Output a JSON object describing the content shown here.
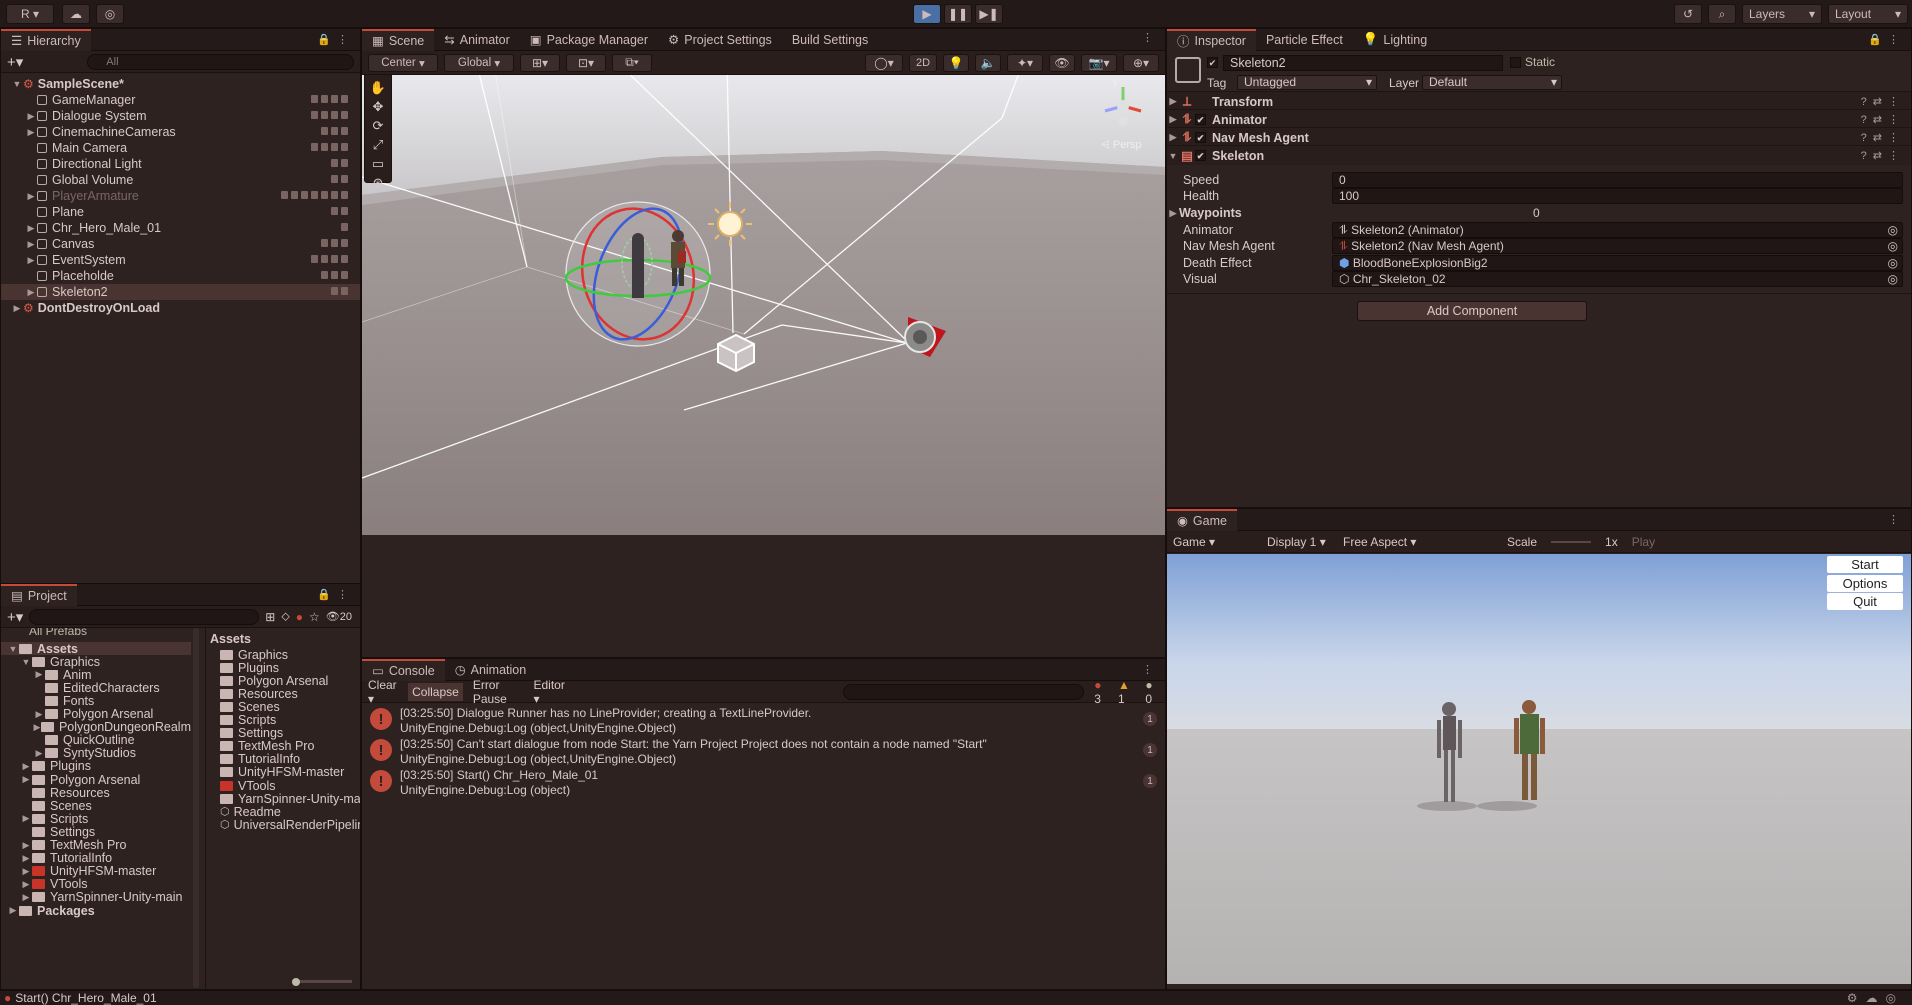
{
  "topbar": {
    "account": "R",
    "play_controls": [
      "play",
      "pause",
      "step"
    ],
    "layers_label": "Layers",
    "layout_label": "Layout"
  },
  "hierarchy": {
    "tab": "Hierarchy",
    "search_placeholder": "All",
    "items": [
      {
        "label": "SampleScene*",
        "level": 0,
        "kind": "scene"
      },
      {
        "label": "GameManager",
        "level": 1
      },
      {
        "label": "Dialogue System",
        "level": 1
      },
      {
        "label": "CinemachineCameras",
        "level": 1
      },
      {
        "label": "Main Camera",
        "level": 1
      },
      {
        "label": "Directional Light",
        "level": 1
      },
      {
        "label": "Global Volume",
        "level": 1
      },
      {
        "label": "PlayerArmature",
        "level": 1,
        "dim": true
      },
      {
        "label": "Plane",
        "level": 1
      },
      {
        "label": "Chr_Hero_Male_01",
        "level": 1
      },
      {
        "label": "Canvas",
        "level": 1
      },
      {
        "label": "EventSystem",
        "level": 1
      },
      {
        "label": "Placeholde",
        "level": 1
      },
      {
        "label": "Skeleton2",
        "level": 1,
        "selected": true
      },
      {
        "label": "DontDestroyOnLoad",
        "level": 0,
        "kind": "scene"
      }
    ]
  },
  "scene_tabs": [
    "Scene",
    "Animator",
    "Package Manager",
    "Project Settings",
    "Build Settings"
  ],
  "scene_toolbar": {
    "pivot": "Center",
    "space": "Global",
    "mode_2d": "2D"
  },
  "scene_gizmo": {
    "projection": "Persp",
    "y_axis": "y"
  },
  "inspector": {
    "tabs": [
      "Inspector",
      "Particle Effect",
      "Lighting"
    ],
    "object_name": "Skeleton2",
    "static_label": "Static",
    "tag_label": "Tag",
    "tag_value": "Untagged",
    "layer_label": "Layer",
    "layer_value": "Default",
    "components": [
      "Transform",
      "Animator",
      "Nav Mesh Agent",
      "Skeleton"
    ],
    "fields": {
      "speed_label": "Speed",
      "speed_value": "0",
      "health_label": "Health",
      "health_value": "100",
      "waypoints_label": "Waypoints",
      "waypoints_value": "0",
      "animator_label": "Animator",
      "animator_value": "Skeleton2 (Animator)",
      "navmesh_label": "Nav Mesh Agent",
      "navmesh_value": "Skeleton2 (Nav Mesh Agent)",
      "death_label": "Death Effect",
      "death_value": "BloodBoneExplosionBig2",
      "visual_label": "Visual",
      "visual_value": "Chr_Skeleton_02"
    },
    "add_component": "Add Component"
  },
  "project": {
    "tab": "Project",
    "filter_count": "20",
    "breadcrumb_top": "All Prefabs",
    "tree": [
      {
        "label": "Assets",
        "level": 0,
        "bold": true
      },
      {
        "label": "Graphics",
        "level": 1
      },
      {
        "label": "Anim",
        "level": 2
      },
      {
        "label": "EditedCharacters",
        "level": 2
      },
      {
        "label": "Fonts",
        "level": 2
      },
      {
        "label": "Polygon Arsenal",
        "level": 2
      },
      {
        "label": "PolygonDungeonRealm",
        "level": 2
      },
      {
        "label": "QuickOutline",
        "level": 2
      },
      {
        "label": "SyntyStudios",
        "level": 2
      },
      {
        "label": "Plugins",
        "level": 1
      },
      {
        "label": "Polygon Arsenal",
        "level": 1
      },
      {
        "label": "Resources",
        "level": 1
      },
      {
        "label": "Scenes",
        "level": 1
      },
      {
        "label": "Scripts",
        "level": 1
      },
      {
        "label": "Settings",
        "level": 1
      },
      {
        "label": "TextMesh Pro",
        "level": 1
      },
      {
        "label": "TutorialInfo",
        "level": 1
      },
      {
        "label": "UnityHFSM-master",
        "level": 1,
        "red": true
      },
      {
        "label": "VTools",
        "level": 1,
        "red": true
      },
      {
        "label": "YarnSpinner-Unity-main",
        "level": 1
      },
      {
        "label": "Packages",
        "level": 0,
        "bold": true
      }
    ],
    "assets_header": "Assets",
    "assets": [
      {
        "label": "Graphics"
      },
      {
        "label": "Plugins"
      },
      {
        "label": "Polygon Arsenal"
      },
      {
        "label": "Resources"
      },
      {
        "label": "Scenes"
      },
      {
        "label": "Scripts"
      },
      {
        "label": "Settings"
      },
      {
        "label": "TextMesh Pro"
      },
      {
        "label": "TutorialInfo"
      },
      {
        "label": "UnityHFSM-master"
      },
      {
        "label": "VTools",
        "red": true
      },
      {
        "label": "YarnSpinner-Unity-main"
      },
      {
        "label": "Readme",
        "file": true
      },
      {
        "label": "UniversalRenderPipelineGlobalSetti",
        "file": true
      }
    ]
  },
  "console": {
    "tabs": [
      "Console",
      "Animation"
    ],
    "toolbar": {
      "clear": "Clear",
      "collapse": "Collapse",
      "error_pause": "Error Pause",
      "editor": "Editor"
    },
    "counts": {
      "errors": "3",
      "warnings": "1",
      "messages": "0"
    },
    "entries": [
      {
        "line1": "[03:25:50] Dialogue Runner has no LineProvider; creating a TextLineProvider.",
        "line2": "UnityEngine.Debug:Log (object,UnityEngine.Object)",
        "count": "1"
      },
      {
        "line1": "[03:25:50] Can't start dialogue from node Start: the Yarn Project Project does not contain a node named \"Start\"",
        "line2": "UnityEngine.Debug:Log (object,UnityEngine.Object)",
        "count": "1"
      },
      {
        "line1": "[03:25:50] Start() Chr_Hero_Male_01",
        "line2": "UnityEngine.Debug:Log (object)",
        "count": "1"
      }
    ]
  },
  "game": {
    "tab": "Game",
    "mode": "Game",
    "display": "Display 1",
    "aspect": "Free Aspect",
    "scale_label": "Scale",
    "scale_value": "1x",
    "play_label": "Play",
    "buttons": [
      "Start",
      "Options",
      "Quit"
    ]
  },
  "status": {
    "message": "Start() Chr_Hero_Male_01"
  },
  "colors": {
    "accent": "#c44b3c",
    "panel": "#2e2220",
    "error": "#c44b3c"
  }
}
